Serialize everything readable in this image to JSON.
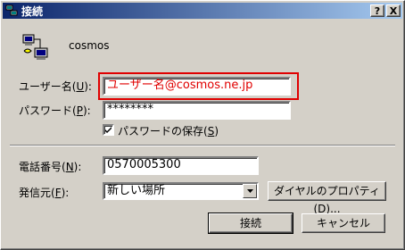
{
  "window": {
    "title": "接続",
    "help_label": "?",
    "close_label": "X",
    "connection_name": "cosmos"
  },
  "form": {
    "username": {
      "label": "ユーザー名(",
      "mnemonic": "U",
      "label_end": "):",
      "value": "ユーザー名@cosmos.ne.jp"
    },
    "password": {
      "label": "パスワード(",
      "mnemonic": "P",
      "label_end": "):",
      "value": "********"
    },
    "save_password": {
      "label": "パスワードの保存(",
      "mnemonic": "S",
      "label_end": ")",
      "checked": true
    },
    "phone": {
      "label": "電話番号(",
      "mnemonic": "N",
      "label_end": "):",
      "value": "0570005300"
    },
    "dial_from": {
      "label": "発信元(",
      "mnemonic": "F",
      "label_end": "):",
      "value": "新しい場所"
    }
  },
  "buttons": {
    "dial_properties": "ダイヤルのプロパティ(D)...",
    "connect": "接続",
    "cancel": "キャンセル"
  },
  "colors": {
    "highlight": "#e00000",
    "titlebar_start": "#0a246a",
    "titlebar_end": "#a6caf0"
  }
}
